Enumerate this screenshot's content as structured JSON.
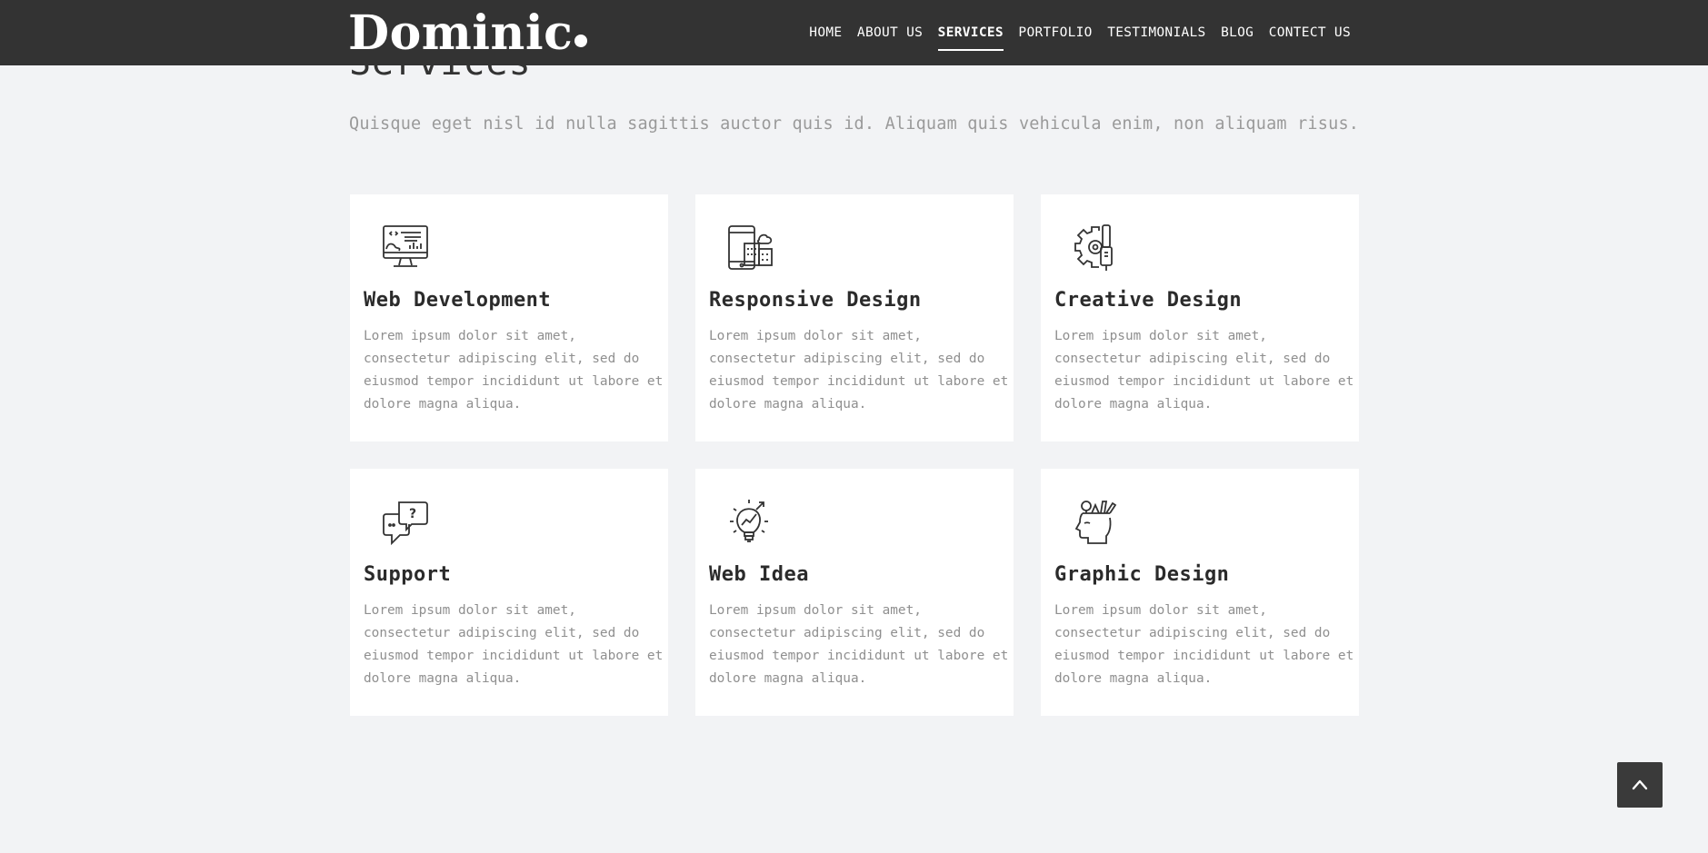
{
  "brand": {
    "name": "Dominic"
  },
  "nav": {
    "items": [
      {
        "label": "HOME",
        "active": false
      },
      {
        "label": "ABOUT US",
        "active": false
      },
      {
        "label": "SERVICES",
        "active": true
      },
      {
        "label": "PORTFOLIO",
        "active": false
      },
      {
        "label": "TESTIMONIALS",
        "active": false
      },
      {
        "label": "BLOG",
        "active": false
      },
      {
        "label": "CONTECT US",
        "active": false
      }
    ]
  },
  "section": {
    "title": "Services",
    "subtitle": "Quisque eget nisl id nulla sagittis auctor quis id. Aliquam quis vehicula enim, non aliquam risus."
  },
  "services": [
    {
      "title": "Web Development",
      "icon": "monitor-code-icon",
      "text": "Lorem ipsum dolor sit amet, consectetur adipiscing elit, sed do eiusmod tempor incididunt ut labore et dolore magna aliqua."
    },
    {
      "title": "Responsive Design",
      "icon": "mobile-building-icon",
      "text": "Lorem ipsum dolor sit amet, consectetur adipiscing elit, sed do eiusmod tempor incididunt ut labore et dolore magna aliqua."
    },
    {
      "title": "Creative Design",
      "icon": "gear-tool-icon",
      "text": "Lorem ipsum dolor sit amet, consectetur adipiscing elit, sed do eiusmod tempor incididunt ut labore et dolore magna aliqua."
    },
    {
      "title": "Support",
      "icon": "chat-question-icon",
      "text": "Lorem ipsum dolor sit amet, consectetur adipiscing elit, sed do eiusmod tempor incididunt ut labore et dolore magna aliqua."
    },
    {
      "title": "Web Idea",
      "icon": "lightbulb-chart-icon",
      "text": "Lorem ipsum dolor sit amet, consectetur adipiscing elit, sed do eiusmod tempor incididunt ut labore et dolore magna aliqua."
    },
    {
      "title": "Graphic Design",
      "icon": "head-tools-icon",
      "text": "Lorem ipsum dolor sit amet, consectetur adipiscing elit, sed do eiusmod tempor incididunt ut labore et dolore magna aliqua."
    }
  ],
  "scroll_top": {
    "icon": "chevron-up-icon"
  },
  "colors": {
    "header_bg": "#333333",
    "page_bg": "#f2f3f5",
    "card_bg": "#ffffff",
    "text_muted": "#8f8f8f"
  }
}
